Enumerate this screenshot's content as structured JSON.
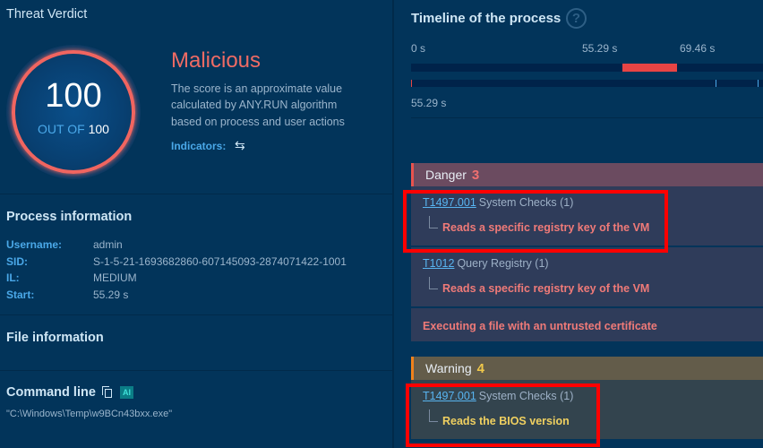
{
  "verdict": {
    "title": "Threat Verdict",
    "score": "100",
    "out_of_label": "OUT OF",
    "out_of_value": "100",
    "status": "Malicious",
    "desc": [
      "The score is an approximate value",
      "calculated by ANY.RUN algorithm",
      "based on process and user actions"
    ],
    "indicators_label": "Indicators:",
    "indicators_icon": "swap-arrows-icon"
  },
  "process": {
    "title": "Process information",
    "rows": [
      {
        "label": "Username:",
        "value": "admin"
      },
      {
        "label": "SID:",
        "value": "S-1-5-21-1693682860-607145093-2874071422-1001"
      },
      {
        "label": "IL:",
        "value": "MEDIUM"
      },
      {
        "label": "Start:",
        "value": "55.29 s"
      }
    ]
  },
  "file": {
    "title": "File information"
  },
  "cmd": {
    "title": "Command line",
    "ai_badge": "AI",
    "value": "\"C:\\Windows\\Temp\\w9BCn43bxx.exe\""
  },
  "timeline": {
    "title": "Timeline of the process",
    "ticks": [
      "0 s",
      "55.29 s",
      "69.46 s"
    ],
    "current": "55.29 s"
  },
  "danger": {
    "label": "Danger",
    "count": "3",
    "color": "#e8534e",
    "items": [
      {
        "tech_id": "T1497.001",
        "tech_name": "System Checks (1)",
        "behavior": "Reads a specific registry key of the VM"
      },
      {
        "tech_id": "T1012",
        "tech_name": "Query Registry (1)",
        "behavior": "Reads a specific registry key of the VM"
      },
      {
        "behavior": "Executing a file with an untrusted certificate"
      }
    ]
  },
  "warning": {
    "label": "Warning",
    "count": "4",
    "color": "#f0821c",
    "items": [
      {
        "tech_id": "T1497.001",
        "tech_name": "System Checks (1)",
        "behavior": "Reads the BIOS version"
      }
    ]
  }
}
